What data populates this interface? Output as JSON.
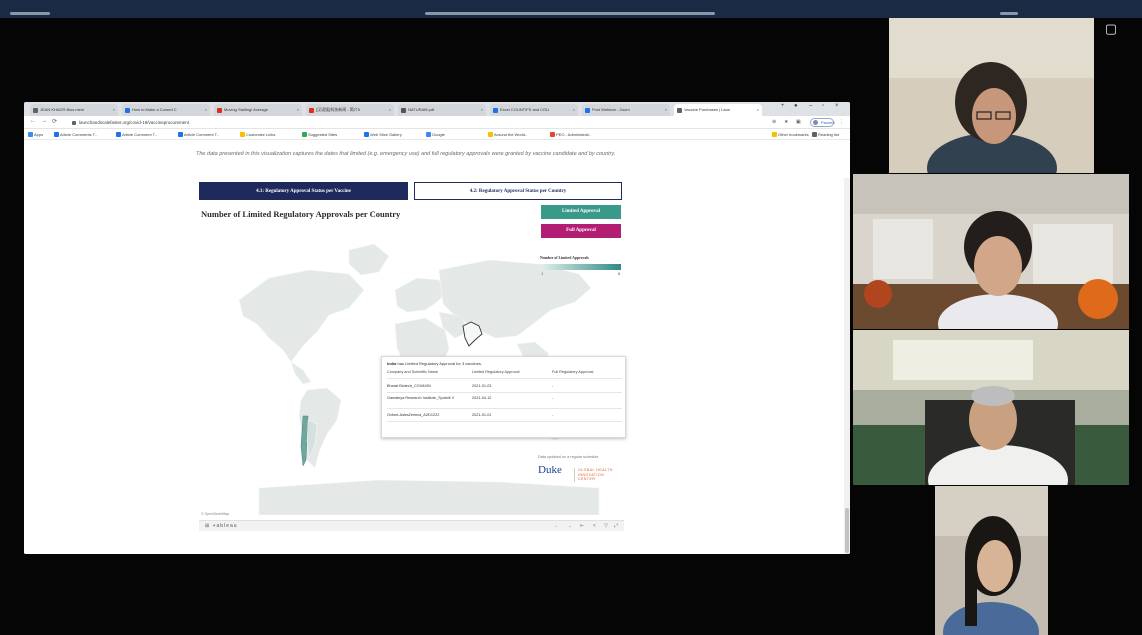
{
  "browser": {
    "tabs": [
      {
        "label": "JEAN KHADR Bios.mem",
        "color": "#5f6368",
        "active": false
      },
      {
        "label": "How to Make a Cursed C",
        "color": "#1a73e8",
        "active": false
      },
      {
        "label": "Moving Stalling! Average",
        "color": "#d93025",
        "active": false
      },
      {
        "label": "[汉语版]科技新闻 - 简介5",
        "color": "#d93025",
        "active": false
      },
      {
        "label": "NATURAM.pdf",
        "color": "#555555",
        "active": false
      },
      {
        "label": "Excel COUNTIFS and COU",
        "color": "#1a73e8",
        "active": false
      },
      {
        "label": "Post Webinar - Zoom",
        "color": "#1a73e8",
        "active": false
      },
      {
        "label": "Vaccine Purchases | Laun",
        "color": "#5f6368",
        "active": true
      }
    ],
    "url": "launchandscalefaster.org/covid-19/vaccineprocurement",
    "profile_label": "Paused",
    "bookmarks": [
      {
        "label": "Apps",
        "color": "#4285f4"
      },
      {
        "label": "Article Comments T..",
        "color": "#1a73e8"
      },
      {
        "label": "Article Comment T..",
        "color": "#1a73e8"
      },
      {
        "label": "Article Comment T..",
        "color": "#1a73e8"
      },
      {
        "label": "Customize Links",
        "color": "#fbbc04"
      },
      {
        "label": "Suggested Sites",
        "color": "#34a853"
      },
      {
        "label": "Web Slice Gallery",
        "color": "#1a73e8"
      },
      {
        "label": "Google",
        "color": "#4285f4"
      },
      {
        "label": "Around the World..",
        "color": "#fbbc04"
      },
      {
        "label": "PEO - Administrati..",
        "color": "#ea4335"
      }
    ],
    "bookmarks_right": [
      {
        "label": "Other bookmarks",
        "color": "#fbbc04"
      },
      {
        "label": "Reading list",
        "color": "#5f6368"
      }
    ]
  },
  "page": {
    "intro_text": "The data presented in this visualization captures the dates that limited (e.g. emergency use) and full regulatory approvals were granted by vaccine candidate and by country.",
    "viz_tabs": [
      {
        "label": "4.1: Regulatory Approval Status per Vaccine",
        "active": true
      },
      {
        "label": "4.2: Regulatory Approval Status per Country",
        "active": false
      }
    ],
    "viz_title": "Number of Limited Regulatory Approvals per Country",
    "legend": {
      "limited_label": "Limited Approval",
      "full_label": "Full Approval",
      "scale_label": "Number of Limited Approvals",
      "scale_min": "1",
      "scale_max": "8",
      "colors": {
        "limited": "#3a9a8a",
        "full": "#b21e73",
        "low": "#e3efec",
        "high": "#2e8b83"
      }
    },
    "tooltip": {
      "country": "India",
      "heading_rest": "has Limited Regulatory Approval for 3 vaccines.",
      "columns": [
        "Company and Scientific Name",
        "Limited Regulatory Approval",
        "Full Regulatory Approval"
      ],
      "rows": [
        {
          "company": "Bharat Biotech_COVAXIN",
          "limited": "2021-01-03",
          "full": "-"
        },
        {
          "company": "Gamaleya Research Institute_Sputnik V",
          "limited": "2021-04-12",
          "full": "-"
        },
        {
          "company": "Oxford-AstraZeneca_AZD1222",
          "limited": "2021-01-01",
          "full": "-"
        }
      ]
    },
    "duke": {
      "note": "Data updated on a regular schedule",
      "logo": "Duke",
      "sub": "GLOBAL HEALTH INNOVATION CENTER"
    },
    "map_credit": "© OpenStreetMap",
    "tableau_logo": "⊞ +ableau"
  }
}
